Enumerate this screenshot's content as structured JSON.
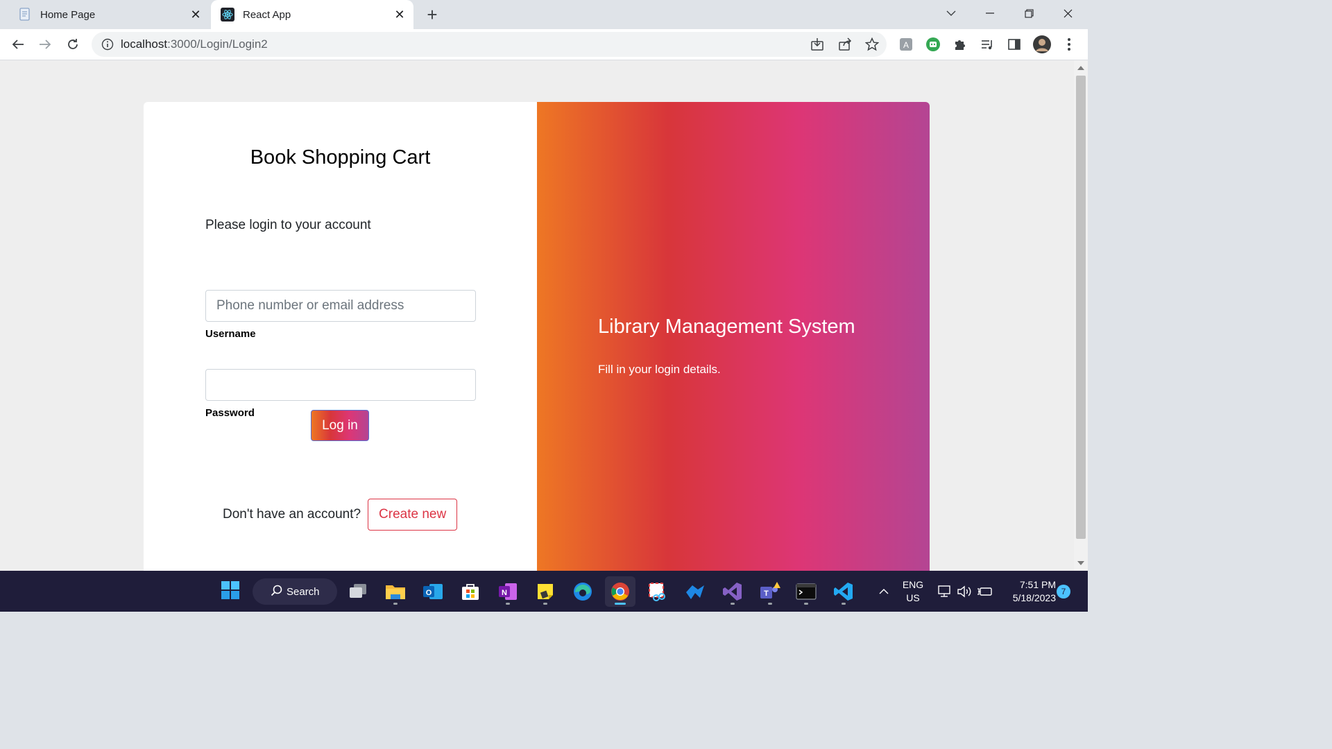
{
  "browser": {
    "tabs": [
      {
        "title": "Home Page",
        "icon": "document-icon"
      },
      {
        "title": "React App",
        "icon": "react-icon"
      }
    ],
    "new_tab": "+",
    "url_host": "localhost",
    "url_path": ":3000/Login/Login2"
  },
  "page": {
    "brand": "Book Shopping Cart",
    "subtitle": "Please login to your account",
    "username_placeholder": "Phone number or email address",
    "username_value": "",
    "username_label": "Username",
    "password_value": "",
    "password_label": "Password",
    "login_button": "Log in",
    "signup_prompt": "Don't have an account?",
    "create_button": "Create new",
    "side_title": "Library Management System",
    "side_text": "Fill in your login details.",
    "gradient_colors": [
      "#ee7724",
      "#d8363a",
      "#dd3675",
      "#b44593"
    ]
  },
  "taskbar": {
    "search_label": "Search",
    "language": "ENG",
    "region": "US",
    "time": "7:51 PM",
    "date": "5/18/2023",
    "notification_count": "7"
  }
}
